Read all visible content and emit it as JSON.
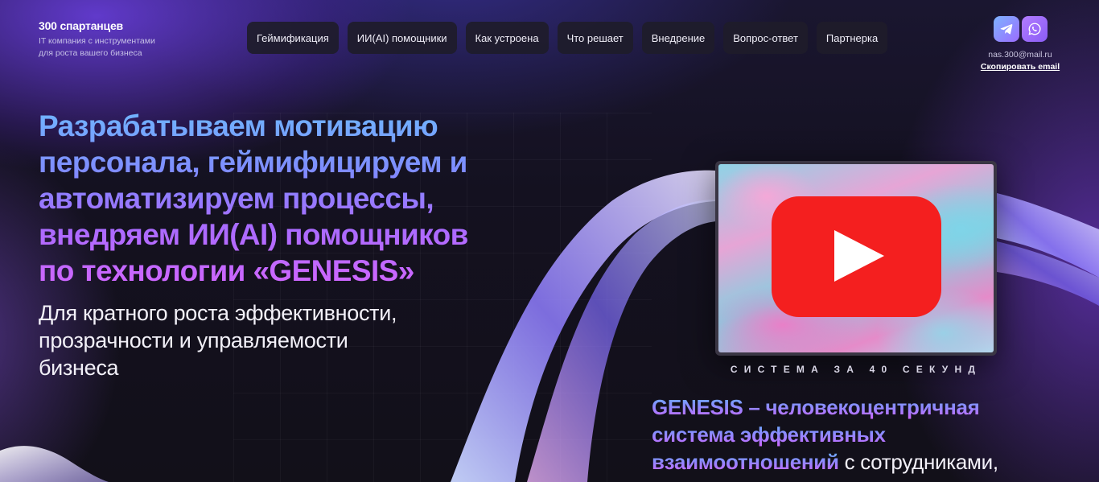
{
  "brand": {
    "name": "300 спартанцев",
    "tagline_line1": "IT компания с инструментами",
    "tagline_line2": "для роста вашего бизнеса"
  },
  "nav": {
    "items": [
      {
        "label": "Геймификация"
      },
      {
        "label": "ИИ(AI) помощники"
      },
      {
        "label": "Как устроена"
      },
      {
        "label": "Что решает"
      },
      {
        "label": "Внедрение"
      },
      {
        "label": "Вопрос-ответ"
      },
      {
        "label": "Партнерка"
      }
    ]
  },
  "contact": {
    "socials": [
      {
        "icon": "telegram-icon"
      },
      {
        "icon": "whatsapp-icon"
      }
    ],
    "email": "nas.300@mail.ru",
    "copy_label": "Скопировать email"
  },
  "hero": {
    "title_lines": [
      "Разрабатываем мотивацию",
      "персонала, геймифицируем и",
      "автоматизируем процессы,",
      "внедряем ИИ(AI) помощников",
      "по технологии «GENESIS»"
    ],
    "subtitle_lines": [
      "Для кратного роста эффективности,",
      "прозрачности и управляемости",
      "бизнеса"
    ]
  },
  "video": {
    "play_icon": "play-icon",
    "caption": "СИСТЕМА ЗА 40 СЕКУНД",
    "play_color": "#f41f1f"
  },
  "genesis": {
    "line1": "GENESIS – человекоцентричная",
    "line2": "система эффективных",
    "line3_highlight": "взаимоотношений",
    "line3_rest": " с сотрудниками,"
  },
  "colors": {
    "accent_blue": "#6fb7ff",
    "accent_purple": "#a86bff",
    "accent_pink": "#d266ff",
    "background": "#131119"
  }
}
